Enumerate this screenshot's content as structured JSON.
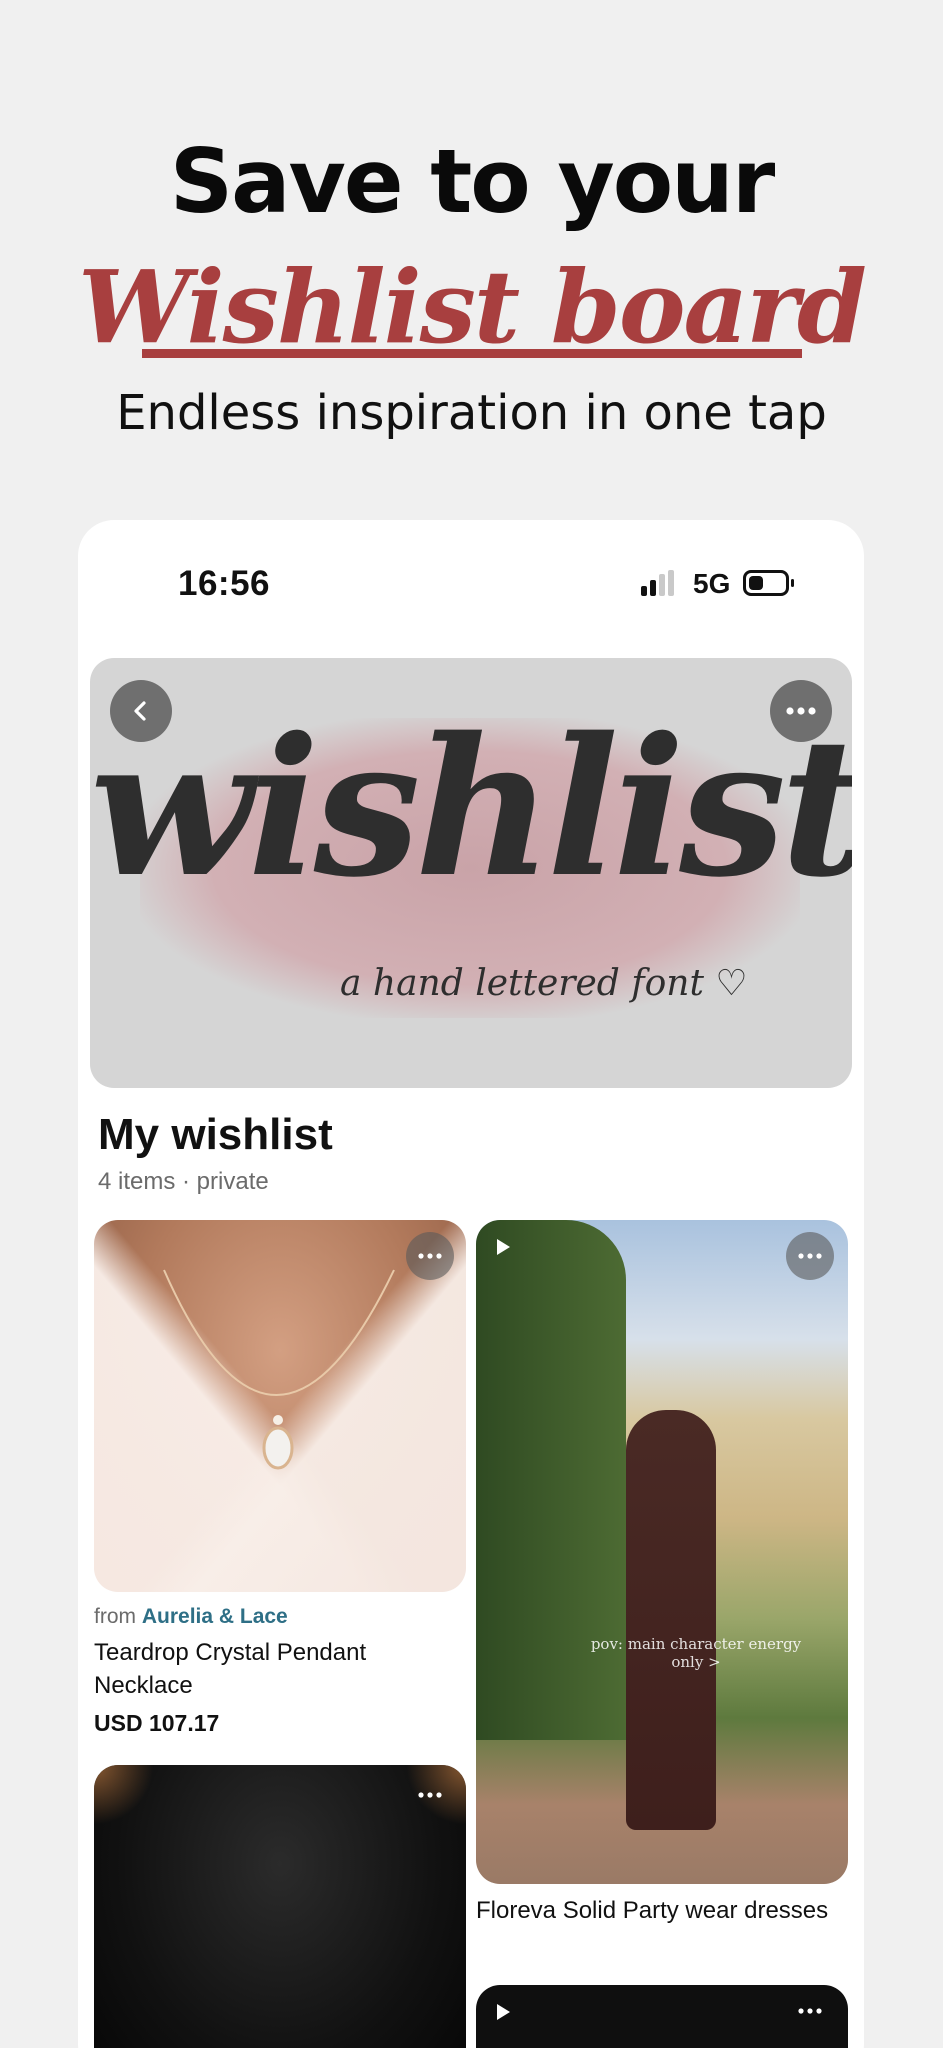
{
  "promo": {
    "headline_line1": "Save to your",
    "headline_line2": "Wishlist board",
    "subheadline": "Endless inspiration in one tap",
    "accent_color": "#a83f3f"
  },
  "status_bar": {
    "time": "16:56",
    "network": "5G",
    "icons": [
      "signal-icon",
      "battery-icon"
    ]
  },
  "banner": {
    "word": "wishlist",
    "tagline": "a hand lettered font ♡",
    "back_icon": "chevron-left-icon",
    "more_icon": "more-icon"
  },
  "board": {
    "title": "My wishlist",
    "meta": "4 items · private"
  },
  "pins": [
    {
      "from_label": "from",
      "merchant": "Aurelia & Lace",
      "title": "Teardrop Crystal Pendant Necklace",
      "price": "USD 107.17",
      "icon": "more-icon"
    },
    {
      "title": "Floreva Solid Party wear dresses",
      "overlay_text": "pov: main character energy only >",
      "icons": [
        "play-icon",
        "more-icon"
      ]
    },
    {
      "icon": "more-icon"
    },
    {
      "icons": [
        "play-icon",
        "more-icon"
      ]
    }
  ],
  "link_color": "#2e6f86"
}
